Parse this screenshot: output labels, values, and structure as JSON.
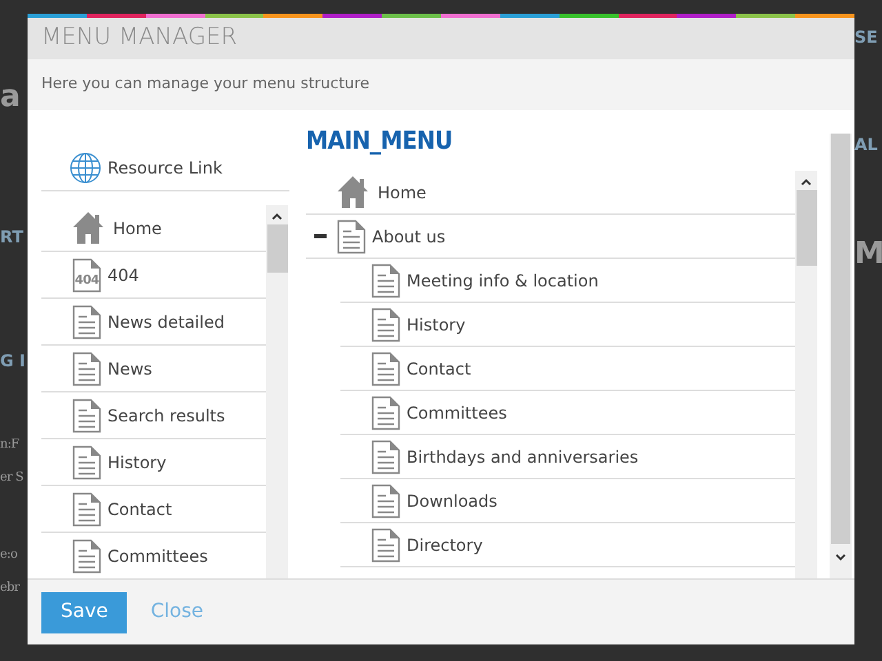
{
  "background_left": [
    {
      "text": "a",
      "kind": "heading"
    },
    {
      "text": "RT",
      "kind": "sub"
    },
    {
      "text": "G I",
      "kind": "sub"
    },
    {
      "text": "n:F",
      "kind": "body"
    },
    {
      "text": "er S",
      "kind": "body"
    },
    {
      "text": "e:o",
      "kind": "body"
    },
    {
      "text": "ebr",
      "kind": "body"
    }
  ],
  "background_right": [
    {
      "text": "SE",
      "kind": "sub"
    },
    {
      "text": "AL",
      "kind": "sub"
    },
    {
      "text": "M",
      "kind": "heading"
    }
  ],
  "dialog": {
    "title": "MENU MANAGER",
    "subtitle": "Here you can manage your menu structure",
    "resource_link": {
      "label": "Resource Link"
    },
    "pages": [
      {
        "kind": "home",
        "label": "Home"
      },
      {
        "kind": "error",
        "icon_text": "404",
        "label": "404"
      },
      {
        "kind": "page",
        "label": "News detailed"
      },
      {
        "kind": "page",
        "label": "News"
      },
      {
        "kind": "page",
        "label": "Search results"
      },
      {
        "kind": "page",
        "label": "History"
      },
      {
        "kind": "page",
        "label": "Contact"
      },
      {
        "kind": "page",
        "label": "Committees"
      }
    ],
    "menu_title": "MAIN_MENU",
    "menu": [
      {
        "kind": "home",
        "label": "Home"
      },
      {
        "kind": "page",
        "label": "About us",
        "expanded": true,
        "children": [
          {
            "kind": "page",
            "label": "Meeting info & location"
          },
          {
            "kind": "page",
            "label": "History"
          },
          {
            "kind": "page",
            "label": "Contact"
          },
          {
            "kind": "page",
            "label": "Committees"
          },
          {
            "kind": "page",
            "label": "Birthdays and anniversaries"
          },
          {
            "kind": "page",
            "label": "Downloads"
          },
          {
            "kind": "page",
            "label": "Directory"
          }
        ]
      }
    ],
    "buttons": [
      {
        "kind": "primary",
        "label": "Save"
      },
      {
        "kind": "link",
        "label": "Close"
      }
    ]
  }
}
